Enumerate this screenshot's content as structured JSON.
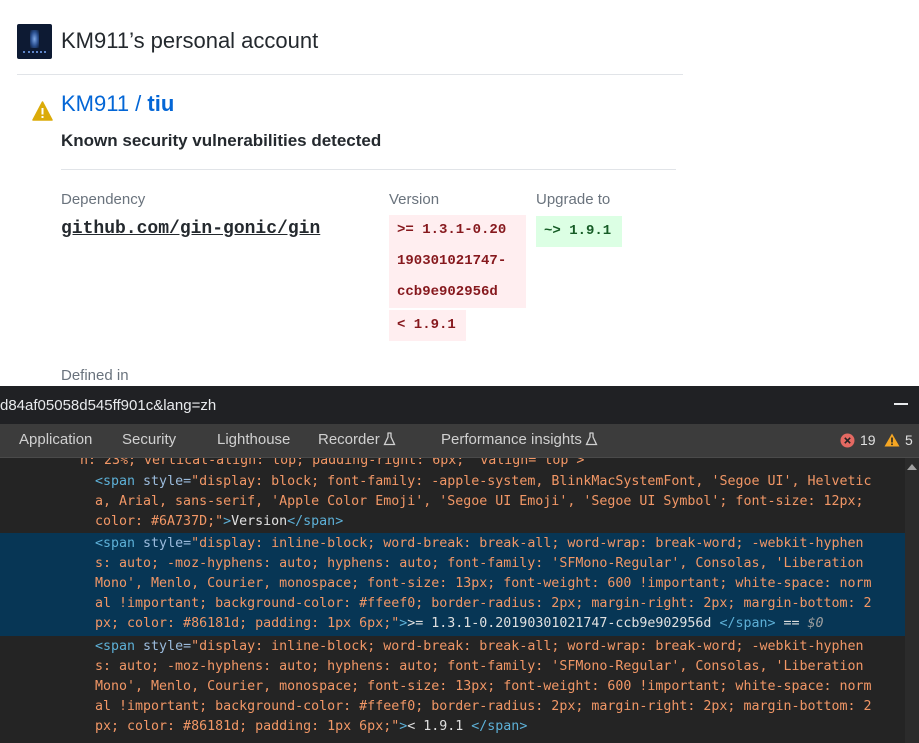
{
  "email": {
    "account_title": "KM911’s personal account",
    "repo_owner": "KM911 / ",
    "repo_name": "tiu",
    "subtitle": "Known security vulnerabilities detected",
    "columns": {
      "dependency": "Dependency",
      "version": "Version",
      "upgrade": "Upgrade to"
    },
    "dependency": "github.com/gin-gonic/gin",
    "version_lines": [
      ">= 1.3.1-0.20",
      "190301021747-",
      "ccb9e902956d"
    ],
    "version_max": "< 1.9.1",
    "upgrade_value": "~> 1.9.1",
    "defined_in": "Defined in"
  },
  "browser": {
    "url_fragment": "d84af05058d545ff901c&lang=zh"
  },
  "devtools": {
    "tabs": [
      "Application",
      "Security",
      "Lighthouse",
      "Recorder",
      "Performance insights"
    ],
    "error_count": "19",
    "warning_count": "5",
    "code": {
      "l1": "h: 23%; vertical-align: top; padding-right: 6px;\" valign=\"top\">",
      "l2_tag": "<span ",
      "l2_attr": "style=",
      "l2_val": "\"display: block; font-family: -apple-system, BlinkMacSystemFont, 'Segoe UI', Helvetic",
      "l3": "a, Arial, sans-serif, 'Apple Color Emoji', 'Segoe UI Emoji', 'Segoe UI Symbol'; font-size: 12px;",
      "l4_val": "color: #6A737D;\"",
      "l4_gt": ">",
      "l4_text": "Version",
      "l4_close": "</span>",
      "l5_tag": "<span ",
      "l5_attr": "style=",
      "l5_val": "\"display: inline-block; word-break: break-all; word-wrap: break-word; -webkit-hyphen",
      "l6": "s: auto; -moz-hyphens: auto; hyphens: auto; font-family: 'SFMono-Regular', Consolas, 'Liberation",
      "l7": "Mono', Menlo, Courier, monospace; font-size: 13px; font-weight: 600 !important; white-space: norm",
      "l8": "al !important; background-color: #ffeef0; border-radius: 2px; margin-right: 2px; margin-bottom: 2",
      "l9_val": "px; color: #86181d; padding: 1px 6px;\"",
      "l9_gt": ">",
      "l9_text": ">= 1.3.1-0.20190301021747-ccb9e902956d ",
      "l9_close": "</span>",
      "l9_eq": " == ",
      "l9_dollar": "$0",
      "l10_tag": "<span ",
      "l10_attr": "style=",
      "l10_val": "\"display: inline-block; word-break: break-all; word-wrap: break-word; -webkit-hyphen",
      "l11": "s: auto; -moz-hyphens: auto; hyphens: auto; font-family: 'SFMono-Regular', Consolas, 'Liberation",
      "l12": "Mono', Menlo, Courier, monospace; font-size: 13px; font-weight: 600 !important; white-space: norm",
      "l13": "al !important; background-color: #ffeef0; border-radius: 2px; margin-right: 2px; margin-bottom: 2",
      "l14_val": "px; color: #86181d; padding: 1px 6px;\"",
      "l14_gt": ">",
      "l14_text": "< 1.9.1 ",
      "l14_close": "</span>"
    }
  }
}
